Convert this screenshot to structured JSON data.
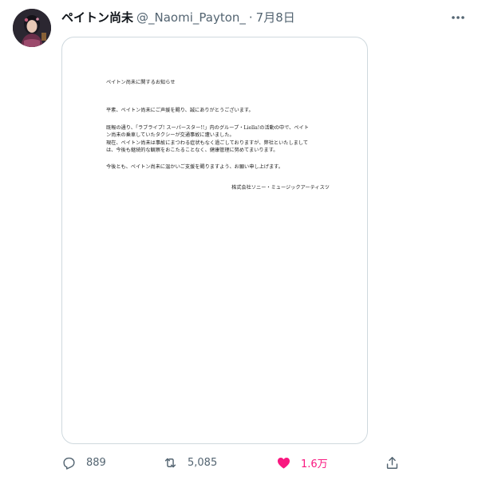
{
  "tweet": {
    "display_name": "ペイトン尚未",
    "handle": "@_Naomi_Payton_",
    "separator": "·",
    "date": "7月8日",
    "avatar_icon": "avatar-image",
    "more_icon": "more-dots-icon"
  },
  "document": {
    "title": "ペイトン尚未に関するお知らせ",
    "p1": "平素、ペイトン尚未にご声援を賜り、誠にありがとうございます。",
    "p2_line1": "既報の通り、「ラブライブ! スーパースター!!」内のグループ・Liella!の活動の中で、ペイト",
    "p2_line2": "ン尚未の乗車していたタクシーが交通事故に遭いました。",
    "p2_line3": "現在、ペイトン尚未は事故にまつわる症状もなく過ごしておりますが、弊社といたしまして",
    "p2_line4": "は、今後も継続的な観察をおこたることなく、健康管理に努めてまいります。",
    "p3": "今後とも、ペイトン尚未に温かいご支援を賜りますよう、お願い申し上げます。",
    "company": "株式会社ソニー・ミュージックアーティスツ"
  },
  "actions": {
    "reply_count": "889",
    "retweet_count": "5,085",
    "like_count": "1.6万",
    "reply_icon": "reply-icon",
    "retweet_icon": "retweet-icon",
    "like_icon": "heart-icon",
    "share_icon": "share-icon",
    "like_color": "#f91880",
    "muted_color": "#536471"
  }
}
